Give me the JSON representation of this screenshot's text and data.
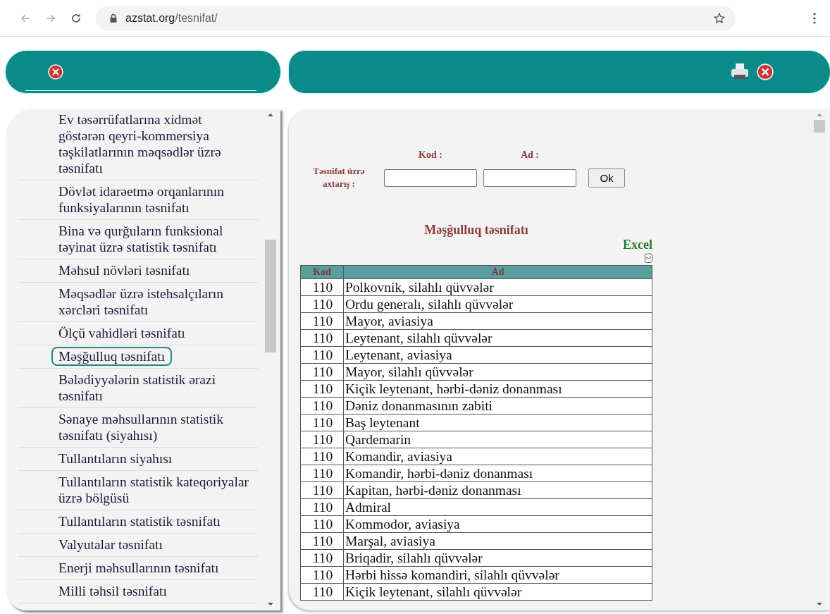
{
  "browser": {
    "url_host": "azstat.org",
    "url_path": "/tesnifat/"
  },
  "sidebar": {
    "items": [
      {
        "label": "Ev təsərrüfatlarına xidmət göstərən qeyri-kommersiya təşkilatlarının məqsədlər üzrə təsnifatı",
        "selected": false
      },
      {
        "label": "Dövlət idarəetmə orqanlarının funksiyalarının təsnifatı",
        "selected": false
      },
      {
        "label": "Bina və qurğuların funksional təyinat üzrə statistik təsnifatı",
        "selected": false
      },
      {
        "label": "Məhsul növləri təsnifatı",
        "selected": false
      },
      {
        "label": "Məqsədlər üzrə istehsalçıların xərcləri təsnifatı",
        "selected": false
      },
      {
        "label": "Ölçü vahidləri təsnifatı",
        "selected": false
      },
      {
        "label": "Məşğulluq təsnifatı",
        "selected": true
      },
      {
        "label": "Bələdiyyələrin statistik ərazi təsnifatı",
        "selected": false
      },
      {
        "label": "Sənaye məhsullarının statistik təsnifatı (siyahısı)",
        "selected": false
      },
      {
        "label": "Tullantıların siyahısı",
        "selected": false
      },
      {
        "label": "Tullantıların statistik kateqoriyalar üzrə bölgüsü",
        "selected": false
      },
      {
        "label": "Tullantıların statistik təsnifatı",
        "selected": false
      },
      {
        "label": "Valyutalar təsnifatı",
        "selected": false
      },
      {
        "label": "Enerji məhsullarının təsnifatı",
        "selected": false
      },
      {
        "label": "Milli təhsil təsnifatı",
        "selected": false
      }
    ]
  },
  "search": {
    "label": "Təsnifat üzrə axtarış :",
    "code_label": "Kod :",
    "name_label": "Ad :",
    "button": "Ok"
  },
  "title": "Məşğulluq təsnifatı",
  "excel_link": "Excel",
  "table": {
    "columns": [
      "Kod",
      "Ad"
    ],
    "rows": [
      [
        "110",
        "Polkovnik, silahlı qüvvələr"
      ],
      [
        "110",
        "Ordu generalı, silahlı qüvvələr"
      ],
      [
        "110",
        "Mayor, aviasiya"
      ],
      [
        "110",
        "Leytenant, silahlı qüvvələr"
      ],
      [
        "110",
        "Leytenant, aviasiya"
      ],
      [
        "110",
        "Mayor, silahlı qüvvələr"
      ],
      [
        "110",
        "Kiçik leytenant, hərbi-dəniz donanması"
      ],
      [
        "110",
        "Dəniz donanmasının zabiti"
      ],
      [
        "110",
        "Baş leytenant"
      ],
      [
        "110",
        "Qardemarin"
      ],
      [
        "110",
        "Komandir, aviasiya"
      ],
      [
        "110",
        "Komandir, hərbi-dəniz donanması"
      ],
      [
        "110",
        "Kapitan, hərbi-dəniz donanması"
      ],
      [
        "110",
        "Admiral"
      ],
      [
        "110",
        "Kommodor, aviasiya"
      ],
      [
        "110",
        "Marşal, aviasiya"
      ],
      [
        "110",
        "Briqadir, silahlı qüvvələr"
      ],
      [
        "110",
        "Hərbi hissə komandiri, silahlı qüvvələr"
      ],
      [
        "110",
        "Kiçik leytenant, silahlı qüvvələr"
      ]
    ]
  }
}
